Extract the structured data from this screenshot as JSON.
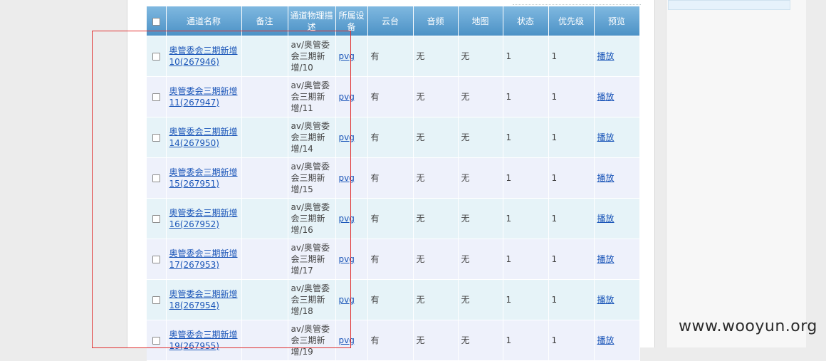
{
  "table": {
    "headers": {
      "name": "通道名称",
      "note": "备注",
      "desc": "通道物理描述",
      "device": "所属设备",
      "ptz": "云台",
      "audio": "音频",
      "map": "地图",
      "status": "状态",
      "priority": "优先级",
      "preview": "预览"
    },
    "rows": [
      {
        "name": "奥管委会三期新增10(267946)",
        "note": "",
        "desc": "av/奥管委会三期新增/10",
        "device": "pvg",
        "ptz": "有",
        "audio": "无",
        "map": "无",
        "status": "1",
        "priority": "1",
        "preview": "播放"
      },
      {
        "name": "奥管委会三期新增11(267947)",
        "note": "",
        "desc": "av/奥管委会三期新增/11",
        "device": "pvg",
        "ptz": "有",
        "audio": "无",
        "map": "无",
        "status": "1",
        "priority": "1",
        "preview": "播放"
      },
      {
        "name": "奥管委会三期新增14(267950)",
        "note": "",
        "desc": "av/奥管委会三期新增/14",
        "device": "pvg",
        "ptz": "有",
        "audio": "无",
        "map": "无",
        "status": "1",
        "priority": "1",
        "preview": "播放"
      },
      {
        "name": "奥管委会三期新增15(267951)",
        "note": "",
        "desc": "av/奥管委会三期新增/15",
        "device": "pvg",
        "ptz": "有",
        "audio": "无",
        "map": "无",
        "status": "1",
        "priority": "1",
        "preview": "播放"
      },
      {
        "name": "奥管委会三期新增16(267952)",
        "note": "",
        "desc": "av/奥管委会三期新增/16",
        "device": "pvg",
        "ptz": "有",
        "audio": "无",
        "map": "无",
        "status": "1",
        "priority": "1",
        "preview": "播放"
      },
      {
        "name": "奥管委会三期新增17(267953)",
        "note": "",
        "desc": "av/奥管委会三期新增/17",
        "device": "pvg",
        "ptz": "有",
        "audio": "无",
        "map": "无",
        "status": "1",
        "priority": "1",
        "preview": "播放"
      },
      {
        "name": "奥管委会三期新增18(267954)",
        "note": "",
        "desc": "av/奥管委会三期新增/18",
        "device": "pvg",
        "ptz": "有",
        "audio": "无",
        "map": "无",
        "status": "1",
        "priority": "1",
        "preview": "播放"
      },
      {
        "name": "奥管委会三期新增19(267955)",
        "note": "",
        "desc": "av/奥管委会三期新增/19",
        "device": "pvg",
        "ptz": "有",
        "audio": "无",
        "map": "无",
        "status": "1",
        "priority": "1",
        "preview": "播放"
      }
    ]
  },
  "watermark": "www.wooyun.org",
  "colors": {
    "header_bg": "#4c92c6",
    "row_odd": "#e6f3f8",
    "row_even": "#eef1fb",
    "link": "#1a55b8",
    "highlight_box": "#e03030"
  }
}
